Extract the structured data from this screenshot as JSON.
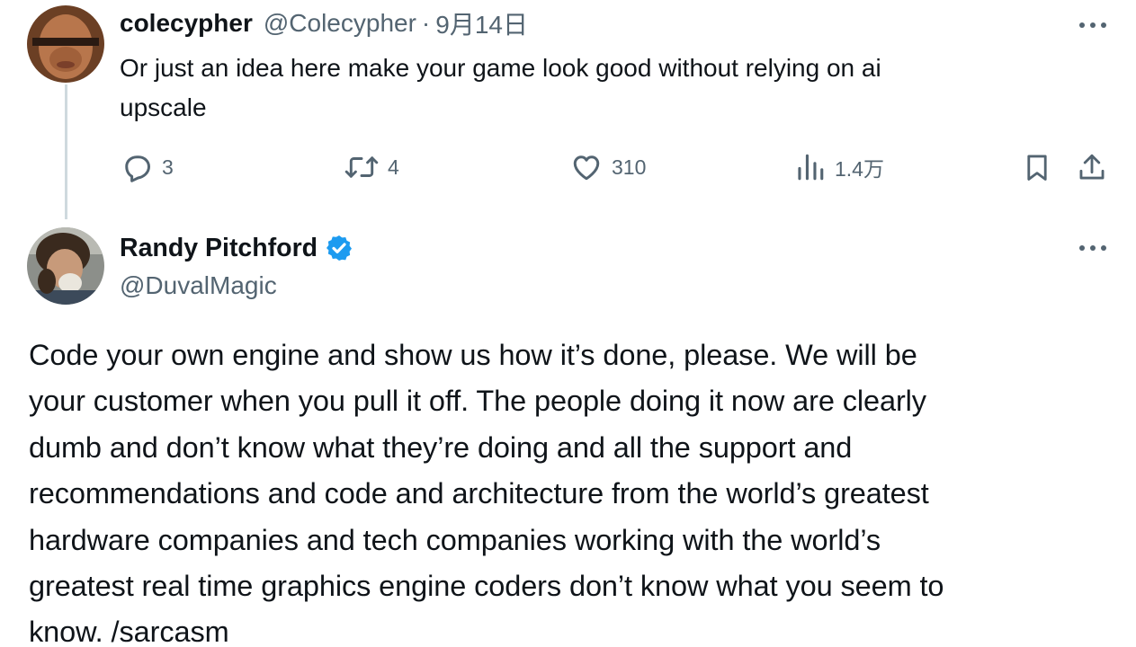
{
  "reply_tweet": {
    "display_name": "colecypher",
    "handle": "@Colecypher",
    "separator": "·",
    "date": "9月14日",
    "text_lines": [
      "Or just an idea here make your game look good without relying on ai",
      "upscale"
    ],
    "actions": {
      "reply_count": "3",
      "retweet_count": "4",
      "like_count": "310",
      "views_count": "1.4万"
    },
    "icons": [
      "more-icon",
      "reply-icon",
      "retweet-icon",
      "like-icon",
      "views-icon",
      "bookmark-icon",
      "share-icon"
    ]
  },
  "main_tweet": {
    "display_name": "Randy Pitchford",
    "handle": "@DuvalMagic",
    "verified": true,
    "verified_color": "#1d9bf0",
    "text_lines": [
      "Code your own engine and show us how it’s done, please.  We will be",
      "your customer when you pull it off. The people doing it now are clearly",
      "dumb and don’t know what they’re doing and all the support and",
      "recommendations and code and architecture from the world’s greatest",
      "hardware companies and tech companies working with the world’s",
      "greatest real time graphics engine coders don’t know what you seem to",
      "know. /sarcasm"
    ]
  },
  "colors": {
    "text": "#0f1419",
    "secondary": "#536471",
    "thread_line": "#cfd9de",
    "background": "#ffffff"
  }
}
